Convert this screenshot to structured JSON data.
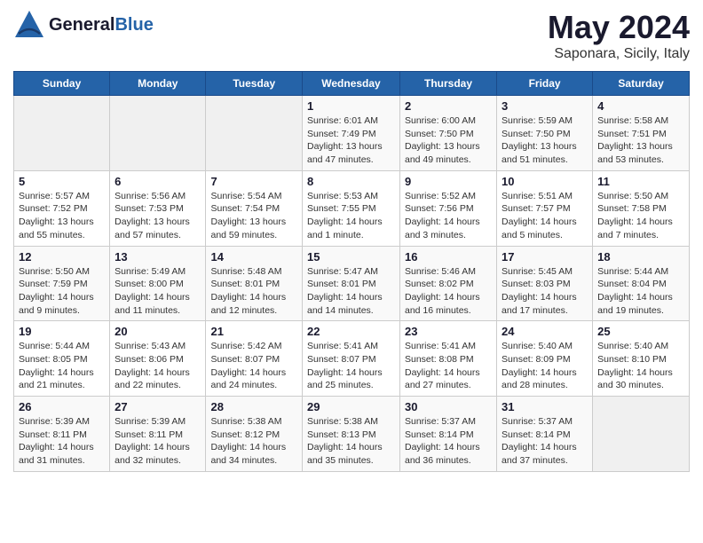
{
  "header": {
    "logo_general": "General",
    "logo_blue": "Blue",
    "title": "May 2024",
    "subtitle": "Saponara, Sicily, Italy"
  },
  "days_of_week": [
    "Sunday",
    "Monday",
    "Tuesday",
    "Wednesday",
    "Thursday",
    "Friday",
    "Saturday"
  ],
  "weeks": [
    [
      {
        "day": "",
        "info": ""
      },
      {
        "day": "",
        "info": ""
      },
      {
        "day": "",
        "info": ""
      },
      {
        "day": "1",
        "info": "Sunrise: 6:01 AM\nSunset: 7:49 PM\nDaylight: 13 hours and 47 minutes."
      },
      {
        "day": "2",
        "info": "Sunrise: 6:00 AM\nSunset: 7:50 PM\nDaylight: 13 hours and 49 minutes."
      },
      {
        "day": "3",
        "info": "Sunrise: 5:59 AM\nSunset: 7:50 PM\nDaylight: 13 hours and 51 minutes."
      },
      {
        "day": "4",
        "info": "Sunrise: 5:58 AM\nSunset: 7:51 PM\nDaylight: 13 hours and 53 minutes."
      }
    ],
    [
      {
        "day": "5",
        "info": "Sunrise: 5:57 AM\nSunset: 7:52 PM\nDaylight: 13 hours and 55 minutes."
      },
      {
        "day": "6",
        "info": "Sunrise: 5:56 AM\nSunset: 7:53 PM\nDaylight: 13 hours and 57 minutes."
      },
      {
        "day": "7",
        "info": "Sunrise: 5:54 AM\nSunset: 7:54 PM\nDaylight: 13 hours and 59 minutes."
      },
      {
        "day": "8",
        "info": "Sunrise: 5:53 AM\nSunset: 7:55 PM\nDaylight: 14 hours and 1 minute."
      },
      {
        "day": "9",
        "info": "Sunrise: 5:52 AM\nSunset: 7:56 PM\nDaylight: 14 hours and 3 minutes."
      },
      {
        "day": "10",
        "info": "Sunrise: 5:51 AM\nSunset: 7:57 PM\nDaylight: 14 hours and 5 minutes."
      },
      {
        "day": "11",
        "info": "Sunrise: 5:50 AM\nSunset: 7:58 PM\nDaylight: 14 hours and 7 minutes."
      }
    ],
    [
      {
        "day": "12",
        "info": "Sunrise: 5:50 AM\nSunset: 7:59 PM\nDaylight: 14 hours and 9 minutes."
      },
      {
        "day": "13",
        "info": "Sunrise: 5:49 AM\nSunset: 8:00 PM\nDaylight: 14 hours and 11 minutes."
      },
      {
        "day": "14",
        "info": "Sunrise: 5:48 AM\nSunset: 8:01 PM\nDaylight: 14 hours and 12 minutes."
      },
      {
        "day": "15",
        "info": "Sunrise: 5:47 AM\nSunset: 8:01 PM\nDaylight: 14 hours and 14 minutes."
      },
      {
        "day": "16",
        "info": "Sunrise: 5:46 AM\nSunset: 8:02 PM\nDaylight: 14 hours and 16 minutes."
      },
      {
        "day": "17",
        "info": "Sunrise: 5:45 AM\nSunset: 8:03 PM\nDaylight: 14 hours and 17 minutes."
      },
      {
        "day": "18",
        "info": "Sunrise: 5:44 AM\nSunset: 8:04 PM\nDaylight: 14 hours and 19 minutes."
      }
    ],
    [
      {
        "day": "19",
        "info": "Sunrise: 5:44 AM\nSunset: 8:05 PM\nDaylight: 14 hours and 21 minutes."
      },
      {
        "day": "20",
        "info": "Sunrise: 5:43 AM\nSunset: 8:06 PM\nDaylight: 14 hours and 22 minutes."
      },
      {
        "day": "21",
        "info": "Sunrise: 5:42 AM\nSunset: 8:07 PM\nDaylight: 14 hours and 24 minutes."
      },
      {
        "day": "22",
        "info": "Sunrise: 5:41 AM\nSunset: 8:07 PM\nDaylight: 14 hours and 25 minutes."
      },
      {
        "day": "23",
        "info": "Sunrise: 5:41 AM\nSunset: 8:08 PM\nDaylight: 14 hours and 27 minutes."
      },
      {
        "day": "24",
        "info": "Sunrise: 5:40 AM\nSunset: 8:09 PM\nDaylight: 14 hours and 28 minutes."
      },
      {
        "day": "25",
        "info": "Sunrise: 5:40 AM\nSunset: 8:10 PM\nDaylight: 14 hours and 30 minutes."
      }
    ],
    [
      {
        "day": "26",
        "info": "Sunrise: 5:39 AM\nSunset: 8:11 PM\nDaylight: 14 hours and 31 minutes."
      },
      {
        "day": "27",
        "info": "Sunrise: 5:39 AM\nSunset: 8:11 PM\nDaylight: 14 hours and 32 minutes."
      },
      {
        "day": "28",
        "info": "Sunrise: 5:38 AM\nSunset: 8:12 PM\nDaylight: 14 hours and 34 minutes."
      },
      {
        "day": "29",
        "info": "Sunrise: 5:38 AM\nSunset: 8:13 PM\nDaylight: 14 hours and 35 minutes."
      },
      {
        "day": "30",
        "info": "Sunrise: 5:37 AM\nSunset: 8:14 PM\nDaylight: 14 hours and 36 minutes."
      },
      {
        "day": "31",
        "info": "Sunrise: 5:37 AM\nSunset: 8:14 PM\nDaylight: 14 hours and 37 minutes."
      },
      {
        "day": "",
        "info": ""
      }
    ]
  ]
}
